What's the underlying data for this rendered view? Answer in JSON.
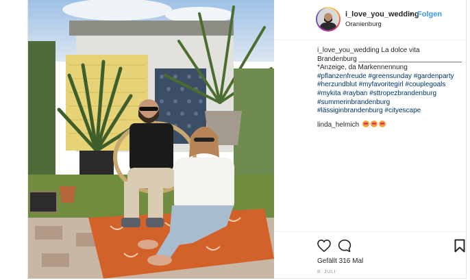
{
  "post": {
    "username": "i_love_you_wedding",
    "separator": "•",
    "follow_label": "Folgen",
    "location": "Oranienburg",
    "caption": {
      "user": "i_love_you_wedding",
      "text_line1": "La dolce vita",
      "text_line2": "Brandenburg ___________________________",
      "text_line3": "*Anzeige, da Markennennung",
      "hashtags": [
        "#pflanzenfreude",
        "#greensunday",
        "#gardenparty",
        "#herzundblut",
        "#myfavoritegirl",
        "#couplegoals",
        "#mykita",
        "#rayban",
        "#sttropezbrandenburg",
        "#summerinbrandenburg",
        "#lässiginbrandenburg",
        "#cityescape"
      ]
    },
    "comment": {
      "user": "linda_helmich"
    },
    "likes_text": "Gefällt 316 Mal",
    "date": "8. JULI"
  },
  "icons": {
    "like": "heart-icon",
    "comment": "speech-bubble-icon",
    "save": "bookmark-icon"
  }
}
